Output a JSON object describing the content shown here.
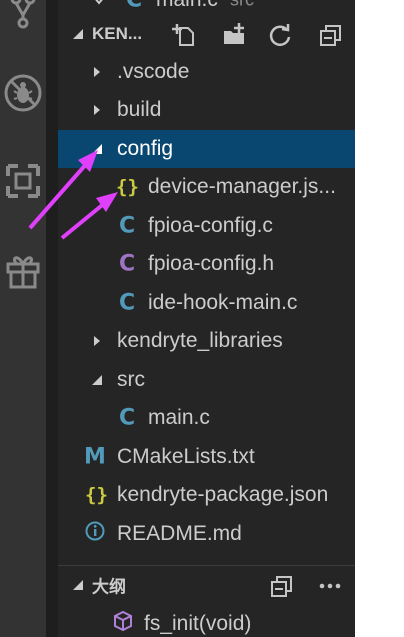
{
  "activity_bar": {
    "icons": [
      "source-control-icon",
      "debug-icon",
      "remote-icon",
      "extensions-gift-icon"
    ]
  },
  "explorer": {
    "top_partial": {
      "label": "main.c",
      "dim": "src"
    },
    "section_title": "KEN...",
    "actions": [
      "new-file-icon",
      "new-folder-icon",
      "refresh-icon",
      "collapse-all-icon"
    ],
    "tree": [
      {
        "label": ".vscode",
        "kind": "folder",
        "state": "collapsed"
      },
      {
        "label": "build",
        "kind": "folder",
        "state": "collapsed"
      },
      {
        "label": "config",
        "kind": "folder",
        "state": "expanded",
        "selected": true
      },
      {
        "label": "device-manager.js...",
        "kind": "json"
      },
      {
        "label": "fpioa-config.c",
        "kind": "c"
      },
      {
        "label": "fpioa-config.h",
        "kind": "h"
      },
      {
        "label": "ide-hook-main.c",
        "kind": "c"
      },
      {
        "label": "kendryte_libraries",
        "kind": "folder",
        "state": "collapsed"
      },
      {
        "label": "src",
        "kind": "folder",
        "state": "expanded"
      },
      {
        "label": "main.c",
        "kind": "c"
      },
      {
        "label": "CMakeLists.txt",
        "kind": "cmake"
      },
      {
        "label": "kendryte-package.json",
        "kind": "json"
      },
      {
        "label": "README.md",
        "kind": "info"
      }
    ],
    "icon_glyphs": {
      "json": "{}",
      "c": "C",
      "h": "C",
      "cmake": "M"
    }
  },
  "outline": {
    "section_title": "大纲",
    "actions": [
      "collapse-all-icon",
      "more-icon"
    ],
    "items": [
      {
        "label": "fs_init(void)",
        "kind": "function"
      }
    ]
  },
  "colors": {
    "selection": "#094771",
    "json_icon": "#cbcb41",
    "c_icon": "#519aba",
    "h_icon": "#a074c4",
    "annotation_arrow": "#e040fb"
  }
}
